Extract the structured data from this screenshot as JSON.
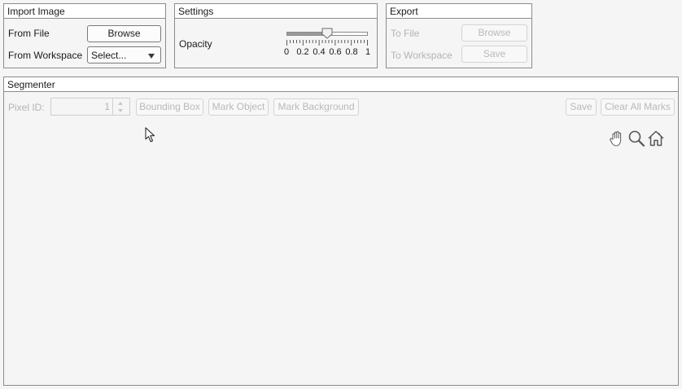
{
  "import_panel": {
    "title": "Import Image",
    "from_file_label": "From File",
    "browse_label": "Browse",
    "from_workspace_label": "From Workspace",
    "workspace_selected": "Select..."
  },
  "settings_panel": {
    "title": "Settings",
    "opacity_label": "Opacity",
    "opacity_value": 0.5,
    "tick_labels": [
      "0",
      "0.2",
      "0.4",
      "0.6",
      "0.8",
      "1"
    ]
  },
  "export_panel": {
    "title": "Export",
    "to_file_label": "To File",
    "browse_label": "Browse",
    "to_workspace_label": "To Workspace",
    "save_label": "Save"
  },
  "segmenter": {
    "title": "Segmenter",
    "pixel_id_label": "Pixel ID:",
    "pixel_id_value": "1",
    "bounding_box_label": "Bounding Box",
    "mark_object_label": "Mark Object",
    "mark_background_label": "Mark Background",
    "save_label": "Save",
    "clear_all_label": "Clear All Marks",
    "tools": [
      "pan-icon",
      "zoom-icon",
      "home-icon"
    ]
  }
}
